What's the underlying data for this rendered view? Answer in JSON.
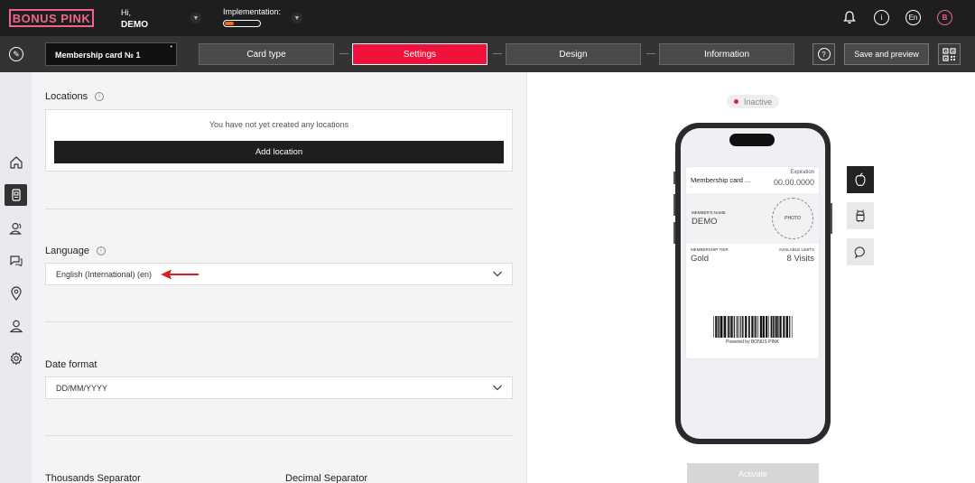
{
  "brand": {
    "logo_text": "BONUS PINK",
    "accent": "#f0648c",
    "active_step_color": "#f0123a"
  },
  "header": {
    "greeting": "Hi,",
    "user_name": "DEMO",
    "implementation_label": "Implementation:",
    "implementation_progress": 0.25,
    "language_badge": "En",
    "avatar_letter": "B"
  },
  "toolbar": {
    "card_name": "Membership card № 1",
    "card_name_marker": "•",
    "steps": [
      {
        "label": "Card type",
        "active": false
      },
      {
        "label": "Settings",
        "active": true
      },
      {
        "label": "Design",
        "active": false
      },
      {
        "label": "Information",
        "active": false
      }
    ],
    "help_symbol": "?",
    "save_label": "Save and preview"
  },
  "sidenav": {
    "items": [
      "home-icon",
      "card-icon",
      "users-icon",
      "chat-icon",
      "location-icon",
      "profile-icon",
      "settings-icon"
    ],
    "active_index": 1
  },
  "form": {
    "locations": {
      "label": "Locations",
      "info_symbol": "i",
      "empty_message": "You have not yet created any locations",
      "add_button": "Add location"
    },
    "language": {
      "label": "Language",
      "info_symbol": "i",
      "value": "English (International) (en)"
    },
    "date_format": {
      "label": "Date format",
      "value": "DD/MM/YYYY"
    },
    "thousands_separator_label": "Thousands Separator",
    "decimal_separator_label": "Decimal Separator"
  },
  "preview": {
    "status": "Inactive",
    "card": {
      "title": "Membership card ...",
      "expiration_label": "Expiration",
      "expiration_value": "00.00.0000",
      "member_name_label": "MEMBER'S NAME",
      "member_name": "DEMO",
      "photo_label": "PHOTO",
      "tier_label": "MEMBERSHIP TIER",
      "tier_value": "Gold",
      "limits_label": "AVAILABLE LIMITS",
      "limits_value": "8 Visits",
      "powered_by": "Powered by BONUS PINK"
    },
    "platforms": [
      "apple-icon",
      "android-icon",
      "message-icon"
    ],
    "active_platform": 0,
    "activate_label": "Activate"
  }
}
